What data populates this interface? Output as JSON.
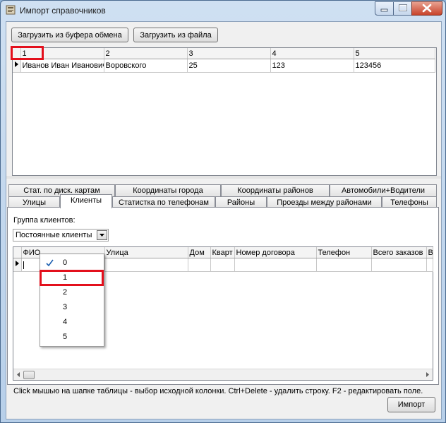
{
  "window": {
    "title": "Импорт справочников"
  },
  "toolbar": {
    "clipboard_label": "Загрузить из буфера обмена",
    "file_label": "Загрузить из файла"
  },
  "top_grid": {
    "columns": [
      "1",
      "2",
      "3",
      "4",
      "5"
    ],
    "rows": [
      [
        "Иванов Иван Иванович",
        "Воровского",
        "25",
        "123",
        "123456"
      ]
    ]
  },
  "tabs": {
    "row1": [
      "Стат. по диск. картам",
      "Координаты города",
      "Координаты районов",
      "Автомобили+Водители"
    ],
    "row2": [
      "Улицы",
      "Клиенты",
      "Статистка по телефонам",
      "Районы",
      "Проезды между районами",
      "Телефоны"
    ],
    "active": "Клиенты"
  },
  "clients": {
    "group_label": "Группа клиентов:",
    "group_value": "Постоянные клиенты",
    "columns": [
      "ФИО",
      "Улица",
      "Дом",
      "Кварт",
      "Номер договора",
      "Телефон",
      "Всего заказов",
      "Вс"
    ]
  },
  "dropdown": {
    "options": [
      "0",
      "1",
      "2",
      "3",
      "4",
      "5"
    ],
    "checked": "0"
  },
  "status_text": "Click мышью на шапке таблицы - выбор исходной колонки. Ctrl+Delete - удалить строку. F2 - редактировать поле.",
  "import_label": "Импорт",
  "colors": {
    "highlight": "#e3101c",
    "check": "#1c5fb0"
  }
}
